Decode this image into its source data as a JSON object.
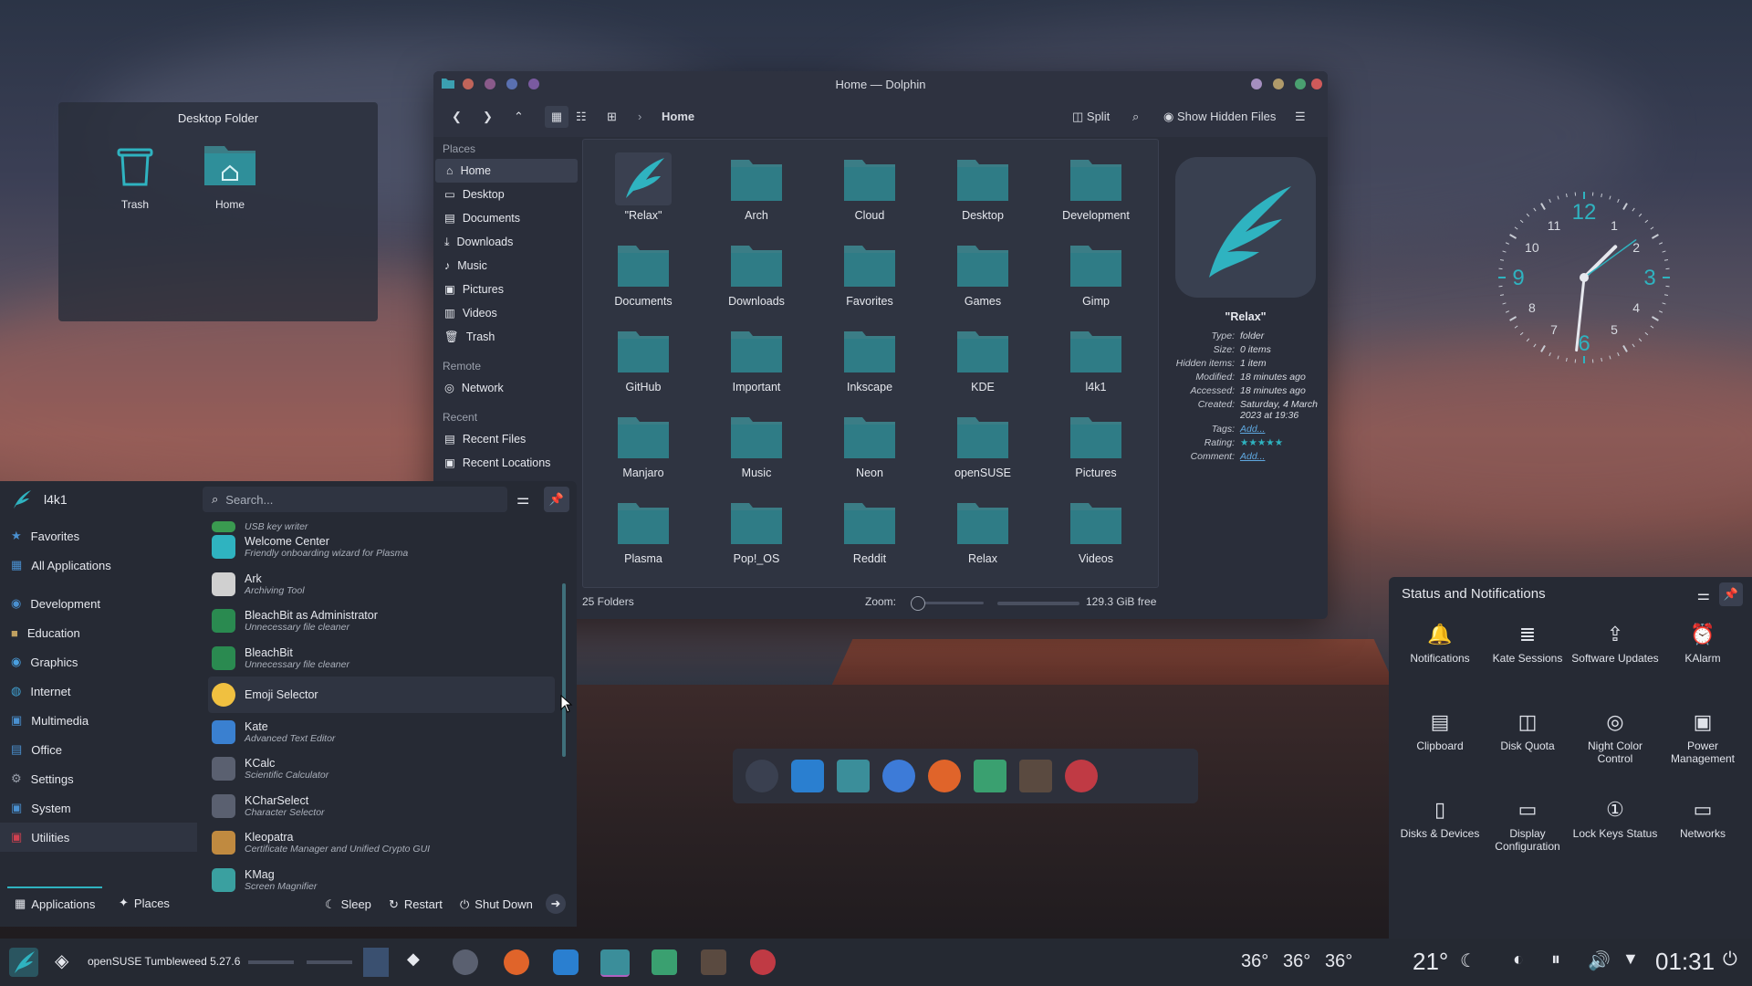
{
  "colors": {
    "accent": "#2fb3c0",
    "folder": "#3b7d86",
    "bg": "#2a2e3a",
    "panel": "#262a34"
  },
  "desktop_folder": {
    "title": "Desktop Folder",
    "items": [
      {
        "label": "Trash",
        "icon": "trash-icon"
      },
      {
        "label": "Home",
        "icon": "home-folder-icon"
      }
    ]
  },
  "dolphin": {
    "title": "Home — Dolphin",
    "breadcrumb": "Home",
    "split_label": "Split",
    "hidden_label": "Show Hidden Files",
    "places_header": "Places",
    "places": [
      "Home",
      "Desktop",
      "Documents",
      "Downloads",
      "Music",
      "Pictures",
      "Videos",
      "Trash"
    ],
    "remote_header": "Remote",
    "remote": [
      "Network"
    ],
    "recent_header": "Recent",
    "recent": [
      "Recent Files",
      "Recent Locations"
    ],
    "folders": [
      "\"Relax\"",
      "Arch",
      "Cloud",
      "Desktop",
      "Development",
      "Documents",
      "Downloads",
      "Favorites",
      "Games",
      "Gimp",
      "GitHub",
      "Important",
      "Inkscape",
      "KDE",
      "l4k1",
      "Manjaro",
      "Music",
      "Neon",
      "openSUSE",
      "Pictures",
      "Plasma",
      "Pop!_OS",
      "Reddit",
      "Relax",
      "Videos"
    ],
    "info": {
      "name": "\"Relax\"",
      "rows": [
        {
          "k": "Type:",
          "v": "folder"
        },
        {
          "k": "Size:",
          "v": "0 items"
        },
        {
          "k": "Hidden items:",
          "v": "1 item"
        },
        {
          "k": "Modified:",
          "v": "18 minutes ago"
        },
        {
          "k": "Accessed:",
          "v": "18 minutes ago"
        },
        {
          "k": "Created:",
          "v": "Saturday, 4 March 2023 at 19:36"
        },
        {
          "k": "Tags:",
          "v": "Add..."
        },
        {
          "k": "Rating:",
          "v": ""
        },
        {
          "k": "Comment:",
          "v": "Add..."
        }
      ],
      "rating": 5
    },
    "status_count": "25 Folders",
    "zoom_label": "Zoom:",
    "free_space": "129.3 GiB free"
  },
  "launcher": {
    "user": "l4k1",
    "search_placeholder": "Search...",
    "categories": [
      "Favorites",
      "All Applications",
      "Development",
      "Education",
      "Graphics",
      "Internet",
      "Multimedia",
      "Office",
      "Settings",
      "System",
      "Utilities"
    ],
    "apps": [
      {
        "name": "",
        "desc": "USB key writer"
      },
      {
        "name": "Welcome Center",
        "desc": "Friendly onboarding wizard for Plasma"
      },
      {
        "name": "Ark",
        "desc": "Archiving Tool"
      },
      {
        "name": "BleachBit as Administrator",
        "desc": "Unnecessary file cleaner"
      },
      {
        "name": "BleachBit",
        "desc": "Unnecessary file cleaner"
      },
      {
        "name": "Emoji Selector",
        "desc": ""
      },
      {
        "name": "Kate",
        "desc": "Advanced Text Editor"
      },
      {
        "name": "KCalc",
        "desc": "Scientific Calculator"
      },
      {
        "name": "KCharSelect",
        "desc": "Character Selector"
      },
      {
        "name": "Kleopatra",
        "desc": "Certificate Manager and Unified Crypto GUI"
      },
      {
        "name": "KMag",
        "desc": "Screen Magnifier"
      }
    ],
    "tab_apps": "Applications",
    "tab_places": "Places",
    "sleep": "Sleep",
    "restart": "Restart",
    "shutdown": "Shut Down"
  },
  "status_notifications": {
    "title": "Status and Notifications",
    "items": [
      "Notifications",
      "Kate Sessions",
      "Software Updates",
      "KAlarm",
      "Clipboard",
      "Disk Quota",
      "Night Color Control",
      "Power Management",
      "Disks & Devices",
      "Display Configuration",
      "Lock Keys Status",
      "Networks"
    ]
  },
  "taskbar": {
    "distro": "openSUSE Tumbleweed 5.27.6",
    "temps": [
      "36°",
      "36°",
      "36°"
    ],
    "weather": "21°",
    "time": "01:31"
  },
  "clock": {
    "numbers": [
      "12",
      "1",
      "2",
      "3",
      "4",
      "5",
      "6",
      "7",
      "8",
      "9",
      "10",
      "11"
    ]
  }
}
